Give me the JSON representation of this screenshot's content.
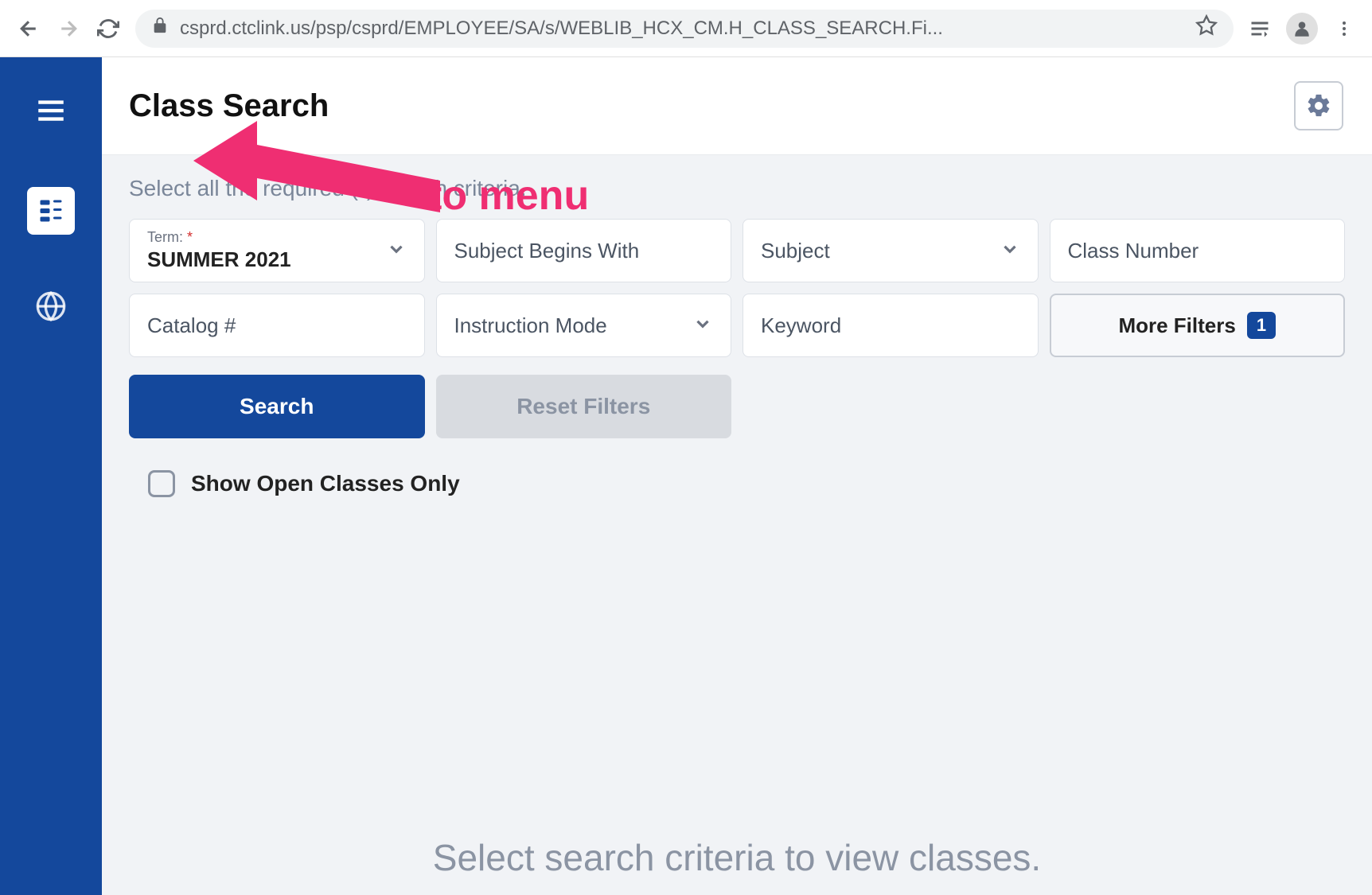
{
  "browser": {
    "url": "csprd.ctclink.us/psp/csprd/EMPLOYEE/SA/s/WEBLIB_HCX_CM.H_CLASS_SEARCH.Fi..."
  },
  "header": {
    "title": "Class Search"
  },
  "content": {
    "instructions": "Select all the required (*) search criteria.",
    "term_label": "Term:",
    "term_required": "*",
    "term_value": "SUMMER 2021",
    "subject_begins_placeholder": "Subject Begins With",
    "subject_placeholder": "Subject",
    "class_number_placeholder": "Class Number",
    "catalog_placeholder": "Catalog #",
    "instruction_mode_placeholder": "Instruction Mode",
    "keyword_placeholder": "Keyword",
    "more_filters_label": "More Filters",
    "more_filters_count": "1",
    "search_button": "Search",
    "reset_button": "Reset Filters",
    "show_open_label": "Show Open Classes Only",
    "empty_state": "Select search criteria to view classes."
  },
  "annotation": {
    "text": "to menu"
  }
}
